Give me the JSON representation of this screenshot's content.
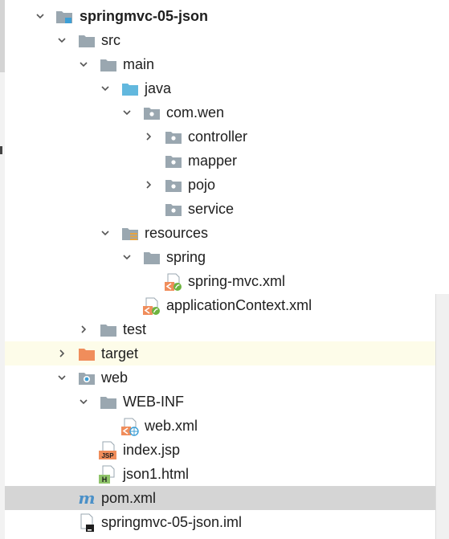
{
  "tree": {
    "project": {
      "label": "springmvc-05-json",
      "icon": "module-folder-icon"
    },
    "src": {
      "label": "src",
      "icon": "folder-icon"
    },
    "main": {
      "label": "main",
      "icon": "folder-icon"
    },
    "java": {
      "label": "java",
      "icon": "source-root-folder-icon"
    },
    "package": {
      "label": "com.wen",
      "icon": "package-icon"
    },
    "controller": {
      "label": "controller",
      "icon": "package-icon"
    },
    "mapper": {
      "label": "mapper",
      "icon": "package-icon"
    },
    "pojo": {
      "label": "pojo",
      "icon": "package-icon"
    },
    "service": {
      "label": "service",
      "icon": "package-icon"
    },
    "resources": {
      "label": "resources",
      "icon": "resources-folder-icon"
    },
    "spring": {
      "label": "spring",
      "icon": "folder-icon"
    },
    "spring_mvc_xml": {
      "label": "spring-mvc.xml",
      "icon": "spring-xml-icon"
    },
    "application_context_xml": {
      "label": "applicationContext.xml",
      "icon": "spring-xml-icon"
    },
    "test": {
      "label": "test",
      "icon": "folder-icon"
    },
    "target": {
      "label": "target",
      "icon": "excluded-folder-icon"
    },
    "web": {
      "label": "web",
      "icon": "web-folder-icon"
    },
    "web_inf": {
      "label": "WEB-INF",
      "icon": "folder-icon"
    },
    "web_xml": {
      "label": "web.xml",
      "icon": "web-xml-icon"
    },
    "index_jsp": {
      "label": "index.jsp",
      "icon": "jsp-file-icon"
    },
    "json1_html": {
      "label": "json1.html",
      "icon": "html-file-icon"
    },
    "pom_xml": {
      "label": "pom.xml",
      "icon": "maven-icon"
    },
    "iml": {
      "label": "springmvc-05-json.iml",
      "icon": "iml-file-icon"
    }
  },
  "icon_glyphs": {
    "jsp": "JSP",
    "html": "H",
    "maven": "m"
  },
  "colors": {
    "folder": "#9aa7b0",
    "source_root": "#62b8de",
    "excluded": "#f08d5b",
    "spring_green": "#6db33f",
    "highlight_row": "#fdfce9",
    "selected_row": "#d5d5d5",
    "maven_blue": "#4a90c8"
  }
}
